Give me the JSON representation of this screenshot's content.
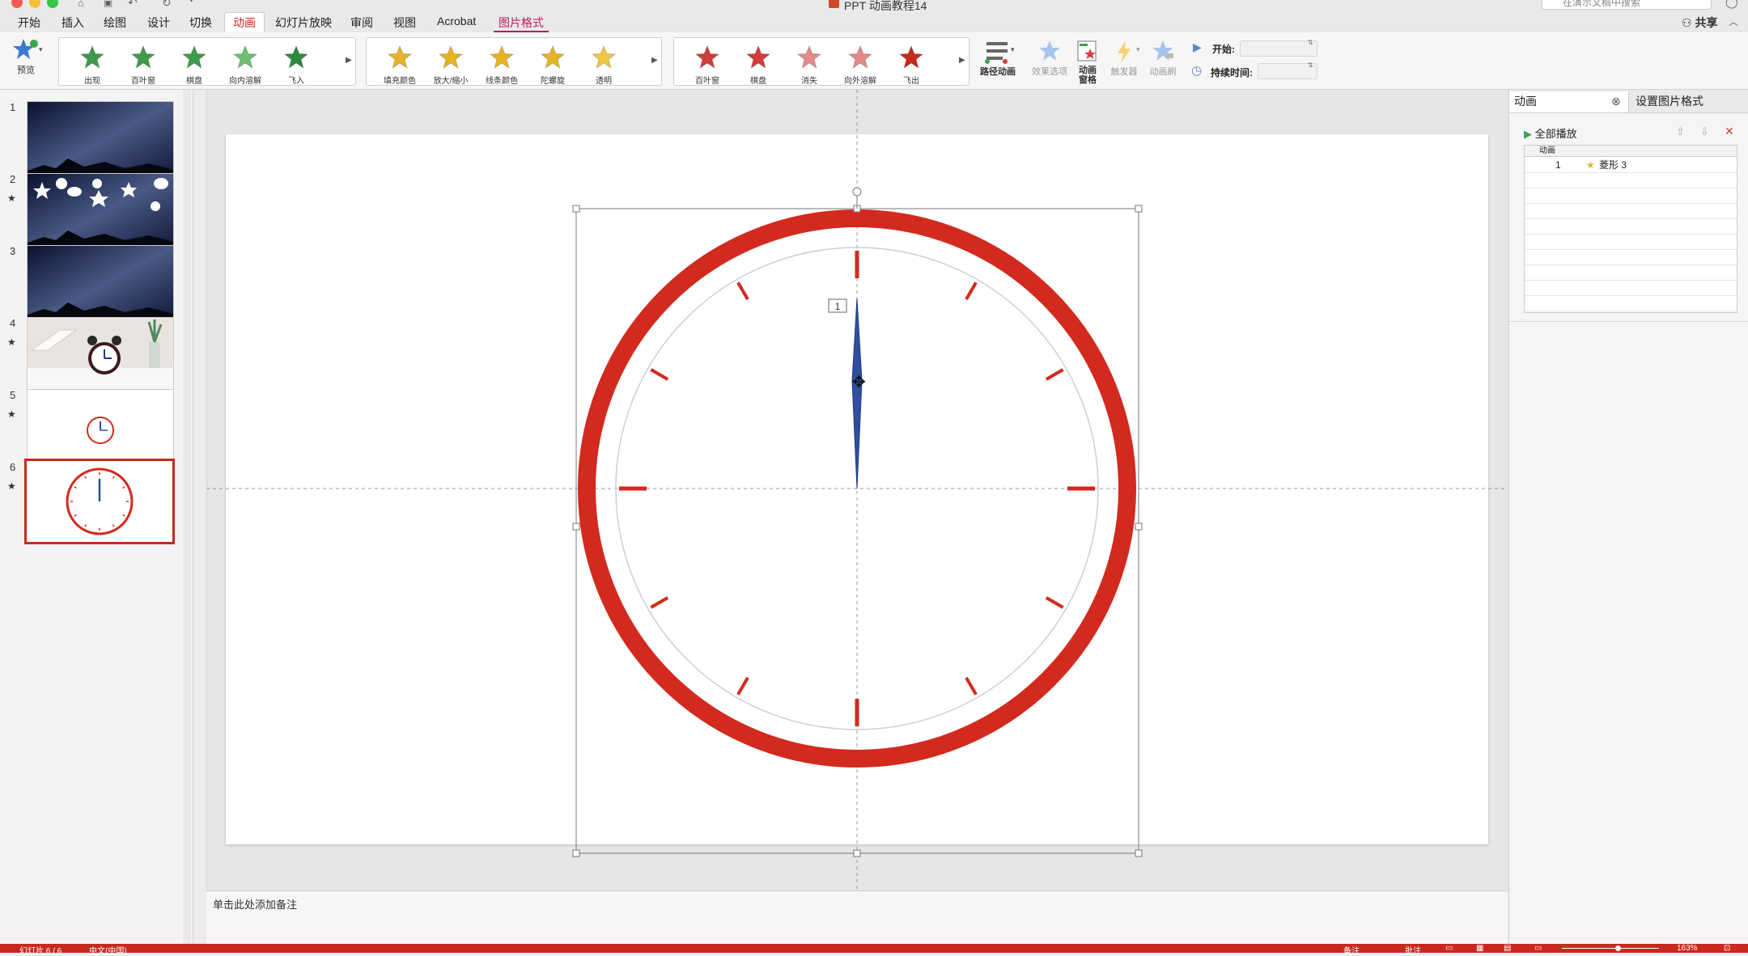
{
  "window": {
    "title": "PPT 动画教程14",
    "search_placeholder": "在演示文稿中搜索",
    "share_label": "共享"
  },
  "tabs": [
    {
      "label": "开始"
    },
    {
      "label": "插入"
    },
    {
      "label": "绘图"
    },
    {
      "label": "设计"
    },
    {
      "label": "切换"
    },
    {
      "label": "动画"
    },
    {
      "label": "幻灯片放映"
    },
    {
      "label": "审阅"
    },
    {
      "label": "视图"
    },
    {
      "label": "Acrobat"
    },
    {
      "label": "图片格式"
    }
  ],
  "ribbon": {
    "preview_label": "预览",
    "entrance": [
      {
        "label": "出现",
        "color": "#3e9b4a"
      },
      {
        "label": "百叶窗",
        "color": "#3e9b4a"
      },
      {
        "label": "棋盘",
        "color": "#3e9b4a"
      },
      {
        "label": "向内溶解",
        "color": "#6fbf73"
      },
      {
        "label": "飞入",
        "color": "#2e8b3e"
      }
    ],
    "emphasis": [
      {
        "label": "填充颜色",
        "color": "#e6b422"
      },
      {
        "label": "放大/缩小",
        "color": "#e6b422"
      },
      {
        "label": "线条颜色",
        "color": "#e6b422"
      },
      {
        "label": "陀螺旋",
        "color": "#e6b422"
      },
      {
        "label": "透明",
        "color": "#f0c840"
      }
    ],
    "exit": [
      {
        "label": "百叶窗",
        "color": "#d23c3c"
      },
      {
        "label": "棋盘",
        "color": "#d23c3c"
      },
      {
        "label": "消失",
        "color": "#e38a8a"
      },
      {
        "label": "向外溶解",
        "color": "#e38a8a"
      },
      {
        "label": "飞出",
        "color": "#c8291f"
      }
    ],
    "path_label": "路径动画",
    "effect_options_label": "效果选项",
    "anim_pane_label_1": "动画",
    "anim_pane_label_2": "窗格",
    "trigger_label": "触发器",
    "anim_painter_label": "动画刷",
    "start_label": "开始:",
    "duration_label": "持续时间:"
  },
  "slides": [
    {
      "number": "1",
      "kind": "milkyway",
      "has_animation": false
    },
    {
      "number": "2",
      "kind": "milkyway-shapes",
      "has_animation": true
    },
    {
      "number": "3",
      "kind": "milkyway",
      "has_animation": false
    },
    {
      "number": "4",
      "kind": "alarm-photo",
      "has_animation": true
    },
    {
      "number": "5",
      "kind": "small-clock",
      "has_animation": true
    },
    {
      "number": "6",
      "kind": "big-clock",
      "has_animation": true,
      "selected": true
    }
  ],
  "animation_star_glyph": "★",
  "canvas": {
    "sequence_tag": "1",
    "accent_color": "#d22a1e",
    "hand_color": "#2e4fa0"
  },
  "notes": {
    "placeholder": "单击此处添加备注"
  },
  "right_pane": {
    "tab_animation": "动画",
    "tab_format_picture": "设置图片格式",
    "play_all_label": "全部播放",
    "list_header": "动画",
    "items": [
      {
        "index": "1",
        "name": "菱形 3"
      }
    ]
  },
  "status": {
    "slide_info": "幻灯片 6 / 6",
    "language": "中文(中国)",
    "notes_btn": "备注",
    "comments_btn": "批注",
    "zoom": "163%"
  }
}
